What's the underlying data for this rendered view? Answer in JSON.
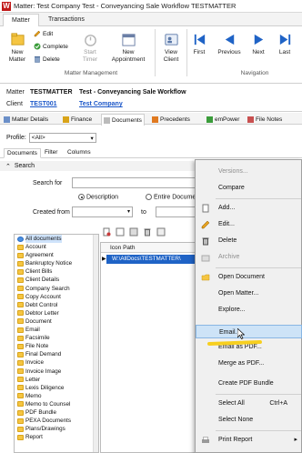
{
  "window": {
    "title": "Matter: Test Company Test - Conveyancing Sale Workflow TESTMATTER",
    "app_icon": "W"
  },
  "ribbon_tabs": [
    {
      "label": "Matter"
    },
    {
      "label": "Transactions"
    }
  ],
  "ribbon": {
    "new_matter": "New\nMatter",
    "edit": "Edit",
    "complete": "Complete",
    "delete": "Delete",
    "start_timer": "Start\nTimer",
    "new_appointment": "New\nAppointment",
    "view_client": "View\nClient",
    "first": "First",
    "previous": "Previous",
    "next": "Next",
    "last": "Last",
    "group_matter_management": "Matter Management",
    "group_navigation": "Navigation"
  },
  "matter": {
    "matter_label": "Matter",
    "matter_value": "TESTMATTER",
    "matter_desc": "Test - Conveyancing Sale Workflow",
    "client_label": "Client",
    "client_value": "TEST001",
    "client_name": "Test Company"
  },
  "nav_tabs": [
    "Matter Details",
    "Finance",
    "Documents",
    "Precedents",
    "emPower",
    "File Notes"
  ],
  "profile": {
    "label": "Profile:",
    "value": "<All>"
  },
  "sub_tabs": [
    "Documents",
    "Filter",
    "Columns"
  ],
  "search": {
    "header": "Search",
    "search_for_label": "Search for",
    "radio_description": "Description",
    "radio_entire": "Entire Documen",
    "created_from_label": "Created from",
    "to_label": "to"
  },
  "tree": {
    "items": [
      "All documents",
      "Account",
      "Agreement",
      "Bankruptcy Notice",
      "Client Bills",
      "Client Details",
      "Company Search",
      "Copy Account",
      "Debt Control",
      "Debtor Letter",
      "Document",
      "Email",
      "Facsimile",
      "File Note",
      "Final Demand",
      "Invoice",
      "Invoice Image",
      "Letter",
      "Lexis Diligence",
      "Memo",
      "Memo to Counsel",
      "PDF Bundle",
      "PEXA Documents",
      "Plans/Drawings",
      "Report"
    ]
  },
  "grid": {
    "column": "Icon Path",
    "row_path": "W:\\AllDocs\\TESTMATTER\\"
  },
  "context_menu": {
    "items": [
      {
        "label": "Versions...",
        "disabled": true
      },
      {
        "label": "Compare",
        "disabled": false
      },
      {
        "label": "Add...",
        "disabled": false
      },
      {
        "label": "Edit...",
        "disabled": false
      },
      {
        "label": "Delete",
        "disabled": false
      },
      {
        "label": "Archive",
        "disabled": true
      },
      {
        "label": "Open Document",
        "disabled": false
      },
      {
        "label": "Open Matter...",
        "disabled": false
      },
      {
        "label": "Explore...",
        "disabled": false
      },
      {
        "label": "Email...",
        "disabled": false,
        "highlighted": true
      },
      {
        "label": "Email as PDF...",
        "disabled": false
      },
      {
        "label": "Merge as PDF...",
        "disabled": false
      },
      {
        "label": "Create PDF Bundle",
        "disabled": false
      },
      {
        "label": "Select All",
        "shortcut": "Ctrl+A",
        "disabled": false
      },
      {
        "label": "Select None",
        "disabled": false
      },
      {
        "label": "Print Report",
        "disabled": false,
        "submenu": true
      }
    ]
  },
  "colors": {
    "accent": "#1f63c6",
    "highlight": "#cde3f7",
    "folder": "#f5c542",
    "underline": "#f7cf1f",
    "link": "#1a56c8",
    "brand_red": "#c01818"
  }
}
